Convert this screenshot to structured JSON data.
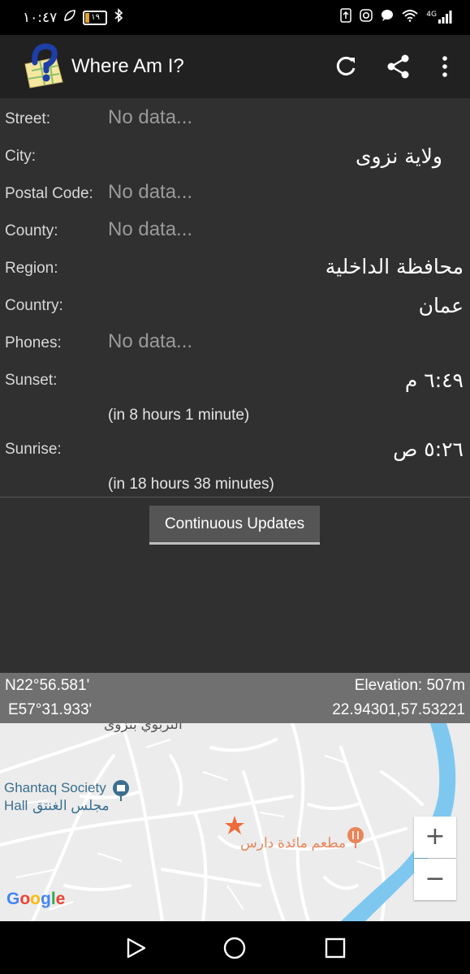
{
  "status_bar": {
    "time": "١٠:٤٧",
    "battery_level": "١٩",
    "network": "4G"
  },
  "app_bar": {
    "title": "Where Am I?"
  },
  "fields": [
    {
      "label": "Street:",
      "value": "No data...",
      "has_data": false
    },
    {
      "label": "City:",
      "value": "ولاية نزوى",
      "has_data": true
    },
    {
      "label": "Postal Code:",
      "value": "No data...",
      "has_data": false
    },
    {
      "label": "County:",
      "value": "No data...",
      "has_data": false
    },
    {
      "label": "Region:",
      "value": "محافظة الداخلية",
      "has_data": true
    },
    {
      "label": "Country:",
      "value": "عمان",
      "has_data": true
    },
    {
      "label": "Phones:",
      "value": "No data...",
      "has_data": false
    }
  ],
  "sunset": {
    "label": "Sunset:",
    "value": "٦:٤٩ م",
    "relative": "(in 8 hours 1 minute)"
  },
  "sunrise": {
    "label": "Sunrise:",
    "value": "٥:٢٦ ص",
    "relative": "(in 18 hours 38 minutes)"
  },
  "continuous_button": "Continuous Updates",
  "coordinates": {
    "lat_dm": "N22°56.581'",
    "lon_dm": "E57°31.933'",
    "elevation": "Elevation: 507m",
    "decimal": "22.94301,57.53221"
  },
  "map": {
    "labels": {
      "top_partial": "التربوي بنزوى",
      "poi_en": "Ghantaq Society",
      "poi_ar_line": "مجلس الغنتق",
      "poi_en_2": "Hall",
      "restaurant": "مطعم مائدة دارس"
    },
    "zoom_in": "+",
    "zoom_out": "−",
    "attribution": "Google",
    "colors": {
      "water": "#7ec8f0",
      "marker": "#ee6b3b",
      "poi_label": "#e8865a",
      "poi_blue": "#3a6f8f"
    }
  }
}
